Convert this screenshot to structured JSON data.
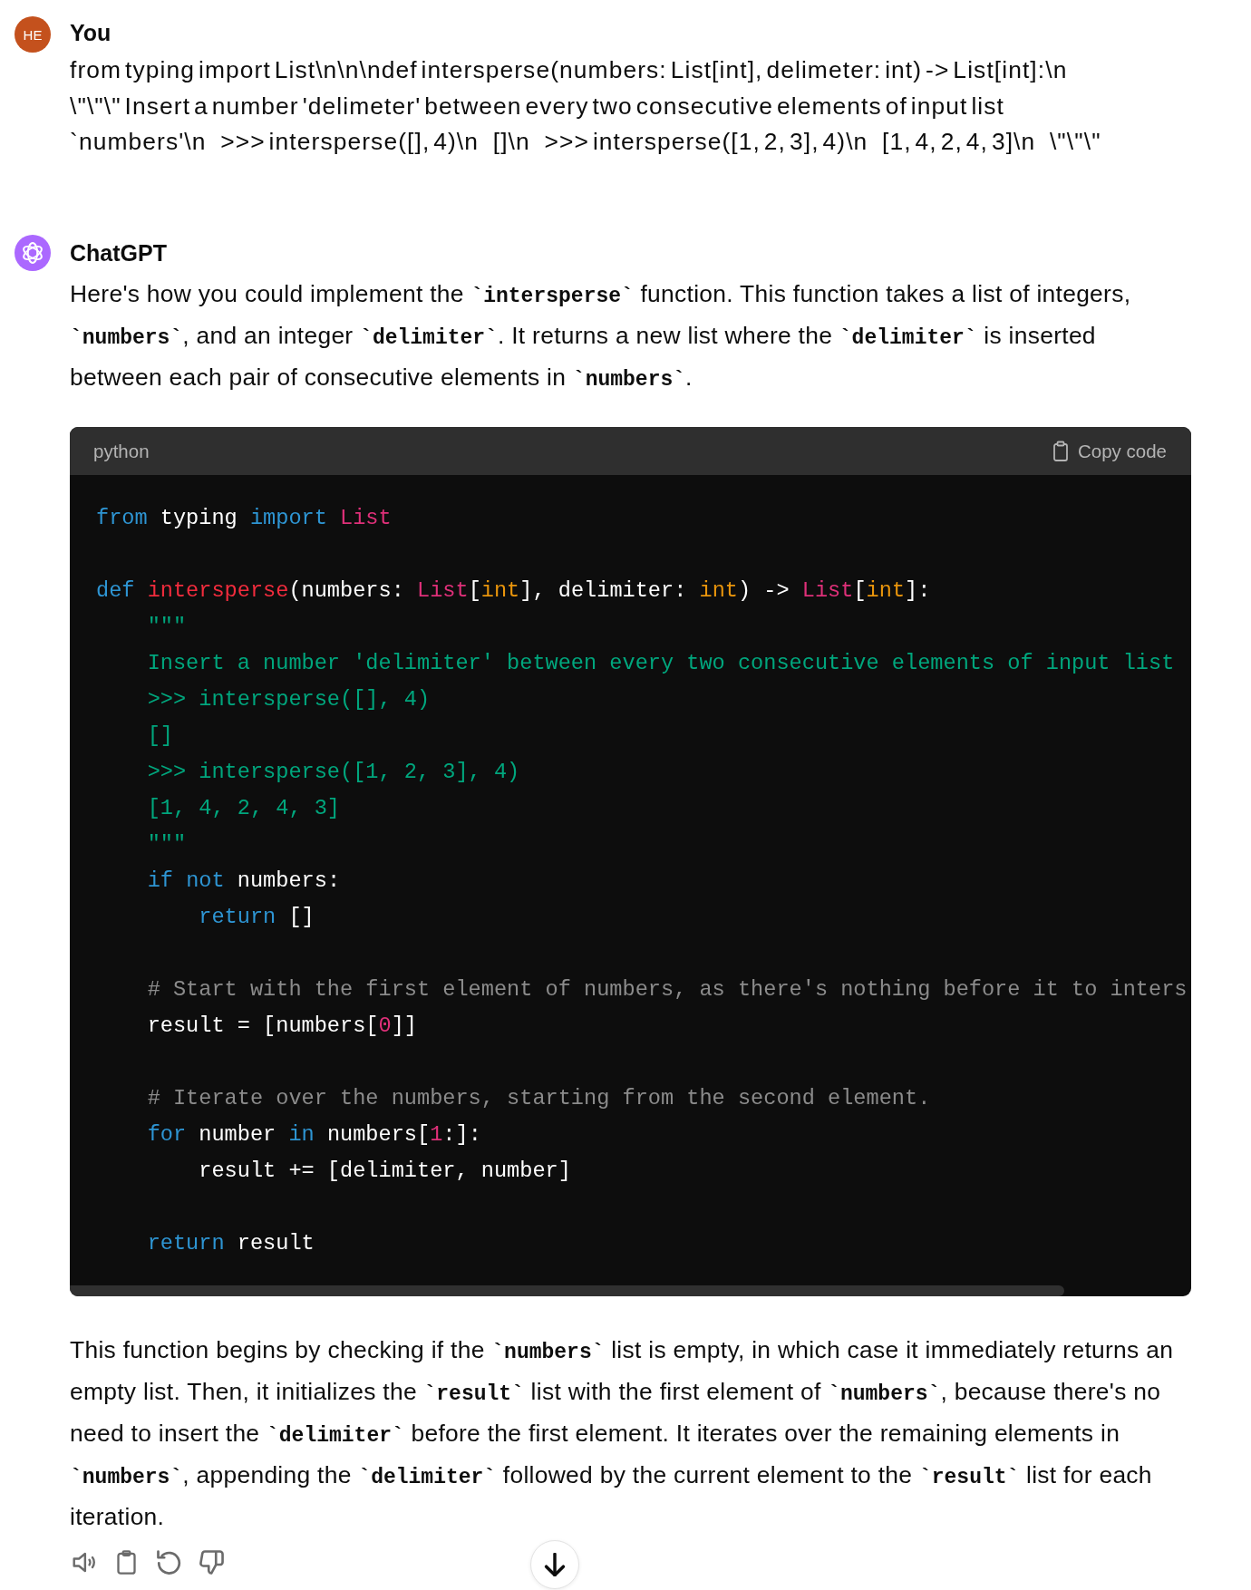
{
  "messages": [
    {
      "kind": "user",
      "avatar": "HE",
      "author": "You",
      "text": "from typing import List\\n\\n\\ndef intersperse(numbers: List[int], delimeter: int) -> List[int]:\\n    \\\"\\\"\\\" Insert a number 'delimeter' between every two consecutive elements of input list `numbers'\\n    >>> intersperse([], 4)\\n    []\\n    >>> intersperse([1, 2, 3], 4)\\n    [1, 4, 2, 4, 3]\\n    \\\"\\\"\\\""
    },
    {
      "kind": "assistant",
      "author": "ChatGPT",
      "content": [
        {
          "kind": "paragraph",
          "segments": [
            {
              "text": "Here's how you could implement the ",
              "kind": "text"
            },
            {
              "text": "`intersperse`",
              "kind": "code"
            },
            {
              "text": " function. This function takes a list of integers, ",
              "kind": "text"
            },
            {
              "text": "`numbers`",
              "kind": "code"
            },
            {
              "text": ", and an integer ",
              "kind": "text"
            },
            {
              "text": "`delimiter`",
              "kind": "code"
            },
            {
              "text": ". It returns a new list where the ",
              "kind": "text"
            },
            {
              "text": "`delimiter`",
              "kind": "code"
            },
            {
              "text": " is inserted between each pair of consecutive elements in ",
              "kind": "text"
            },
            {
              "text": "`numbers`",
              "kind": "code"
            },
            {
              "text": ".",
              "kind": "text"
            }
          ]
        },
        {
          "kind": "code",
          "language": "python",
          "copy_label": "Copy code",
          "groups": [
            [
              [
                {
                  "text": "from",
                  "kind": "keyword"
                },
                {
                  "text": " typing ",
                  "kind": "plain"
                },
                {
                  "text": "import",
                  "kind": "keyword"
                },
                {
                  "text": " List",
                  "kind": "type"
                }
              ]
            ],
            [
              [
                {
                  "text": "def",
                  "kind": "keyword"
                },
                {
                  "text": " intersperse",
                  "kind": "function"
                },
                {
                  "text": "(numbers: ",
                  "kind": "plain"
                },
                {
                  "text": "List",
                  "kind": "type"
                },
                {
                  "text": "[",
                  "kind": "plain"
                },
                {
                  "text": "int",
                  "kind": "builtin"
                },
                {
                  "text": "], delimiter: ",
                  "kind": "plain"
                },
                {
                  "text": "int",
                  "kind": "builtin"
                },
                {
                  "text": ") -> ",
                  "kind": "plain"
                },
                {
                  "text": "List",
                  "kind": "type"
                },
                {
                  "text": "[",
                  "kind": "plain"
                },
                {
                  "text": "int",
                  "kind": "builtin"
                },
                {
                  "text": "]:",
                  "kind": "plain"
                }
              ],
              [
                {
                  "text": "    \"\"\"",
                  "kind": "string"
                }
              ],
              [
                {
                  "text": "    Insert a number 'delimiter' between every two consecutive elements of input list",
                  "kind": "string"
                }
              ],
              [
                {
                  "text": "    >>> intersperse([], 4)",
                  "kind": "string"
                }
              ],
              [
                {
                  "text": "    []",
                  "kind": "string"
                }
              ],
              [
                {
                  "text": "    >>> intersperse([1, 2, 3], 4)",
                  "kind": "string"
                }
              ],
              [
                {
                  "text": "    [1, 4, 2, 4, 3]",
                  "kind": "string"
                }
              ],
              [
                {
                  "text": "    \"\"\"",
                  "kind": "string"
                }
              ],
              [
                {
                  "text": "    if",
                  "kind": "keyword"
                },
                {
                  "text": " not",
                  "kind": "keyword"
                },
                {
                  "text": " numbers:",
                  "kind": "plain"
                }
              ],
              [
                {
                  "text": "        return",
                  "kind": "keyword"
                },
                {
                  "text": " []",
                  "kind": "plain"
                }
              ]
            ],
            [
              [
                {
                  "text": "    # Start with the first element of numbers, as there's nothing before it to inters",
                  "kind": "comment"
                }
              ],
              [
                {
                  "text": "    result = [numbers[",
                  "kind": "plain"
                },
                {
                  "text": "0",
                  "kind": "number"
                },
                {
                  "text": "]]",
                  "kind": "plain"
                }
              ]
            ],
            [
              [
                {
                  "text": "    # Iterate over the numbers, starting from the second element.",
                  "kind": "comment"
                }
              ],
              [
                {
                  "text": "    for",
                  "kind": "keyword"
                },
                {
                  "text": " number ",
                  "kind": "plain"
                },
                {
                  "text": "in",
                  "kind": "keyword"
                },
                {
                  "text": " numbers[",
                  "kind": "plain"
                },
                {
                  "text": "1",
                  "kind": "number"
                },
                {
                  "text": ":]:",
                  "kind": "plain"
                }
              ],
              [
                {
                  "text": "        result += [delimiter, number]",
                  "kind": "plain"
                }
              ]
            ],
            [
              [
                {
                  "text": "    return",
                  "kind": "keyword"
                },
                {
                  "text": " result",
                  "kind": "plain"
                }
              ]
            ]
          ]
        },
        {
          "kind": "paragraph",
          "segments": [
            {
              "text": "This function begins by checking if the ",
              "kind": "text"
            },
            {
              "text": "`numbers`",
              "kind": "code"
            },
            {
              "text": " list is empty, in which case it immediately returns an empty list. Then, it initializes the ",
              "kind": "text"
            },
            {
              "text": "`result`",
              "kind": "code"
            },
            {
              "text": " list with the first element of ",
              "kind": "text"
            },
            {
              "text": "`numbers`",
              "kind": "code"
            },
            {
              "text": ", because there's no need to insert the ",
              "kind": "text"
            },
            {
              "text": "`delimiter`",
              "kind": "code"
            },
            {
              "text": " before the first element. It iterates over the remaining elements in ",
              "kind": "text"
            },
            {
              "text": "`numbers`",
              "kind": "code"
            },
            {
              "text": ", appending the ",
              "kind": "text"
            },
            {
              "text": "`delimiter`",
              "kind": "code"
            },
            {
              "text": " followed by the current element to the ",
              "kind": "text"
            },
            {
              "text": "`result`",
              "kind": "code"
            },
            {
              "text": " list for each iteration.",
              "kind": "text"
            }
          ]
        }
      ]
    }
  ]
}
